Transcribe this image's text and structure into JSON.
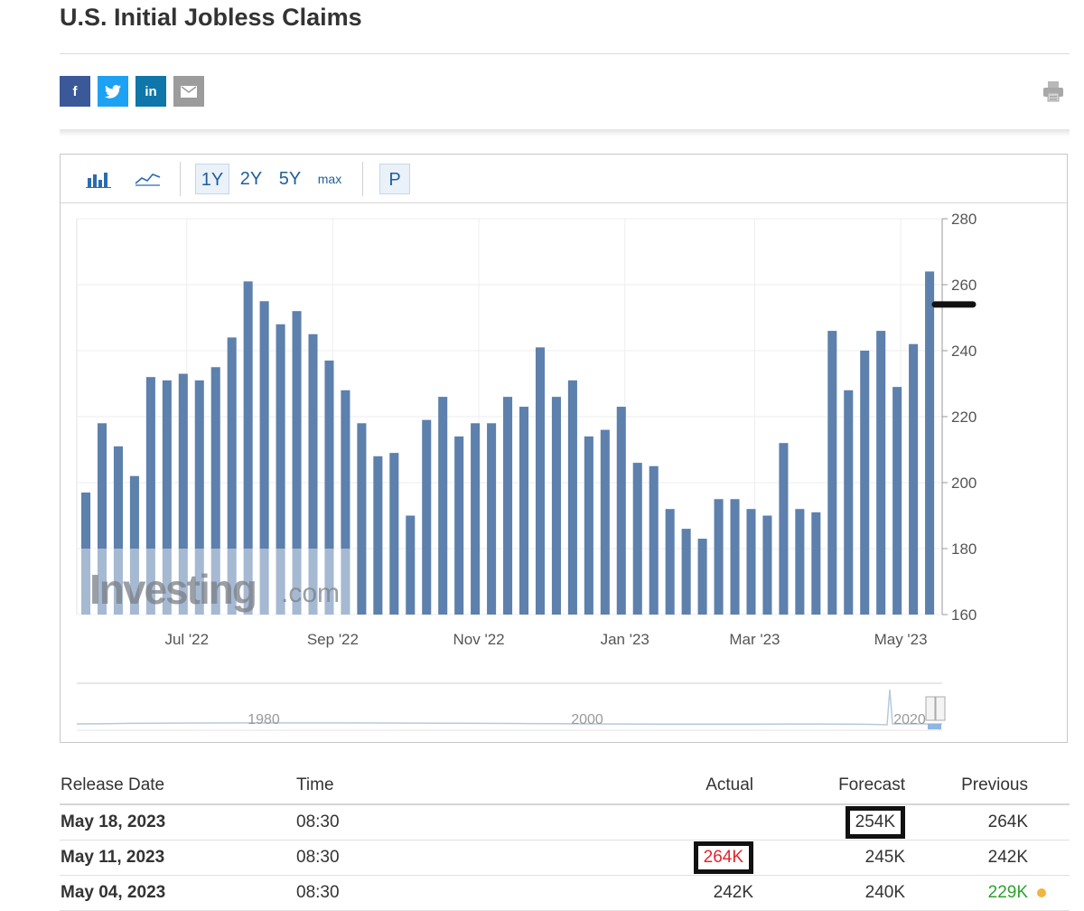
{
  "page": {
    "title": "U.S. Initial Jobless Claims"
  },
  "share": {
    "facebook": "f",
    "twitter": "t",
    "linkedin": "in",
    "email_icon": "envelope-icon",
    "print_icon": "printer-icon"
  },
  "toolbar": {
    "bar_icon": "bar-chart-icon",
    "line_icon": "line-chart-icon",
    "ranges": [
      "1Y",
      "2Y",
      "5Y",
      "max"
    ],
    "selected_range": "1Y",
    "p_label": "P"
  },
  "chart_data": {
    "type": "bar",
    "title": "",
    "xlabel": "",
    "ylabel": "",
    "ylim": [
      160,
      280
    ],
    "yticks": [
      160,
      180,
      200,
      220,
      240,
      260,
      280
    ],
    "xtick_labels": [
      "Jul '22",
      "Sep '22",
      "Nov '22",
      "Jan '23",
      "Mar '23",
      "May '23"
    ],
    "values": [
      197,
      218,
      211,
      202,
      232,
      231,
      233,
      231,
      235,
      244,
      261,
      255,
      248,
      252,
      245,
      237,
      228,
      218,
      208,
      209,
      190,
      219,
      226,
      214,
      218,
      218,
      226,
      223,
      241,
      226,
      231,
      214,
      216,
      223,
      206,
      205,
      192,
      186,
      183,
      195,
      195,
      192,
      190,
      212,
      192,
      191,
      246,
      228,
      240,
      246,
      229,
      242,
      264
    ],
    "forecast_marker": 254,
    "bar_color": "#5d80ad",
    "watermark": "Investing.com",
    "navigator_labels": [
      "1980",
      "2000",
      "2020"
    ]
  },
  "table": {
    "headers": [
      "Release Date",
      "Time",
      "Actual",
      "Forecast",
      "Previous"
    ],
    "rows": [
      {
        "date": "May 18, 2023",
        "time": "08:30",
        "actual": "",
        "forecast": "254K",
        "previous": "264K"
      },
      {
        "date": "May 11, 2023",
        "time": "08:30",
        "actual": "264K",
        "forecast": "245K",
        "previous": "242K"
      },
      {
        "date": "May 04, 2023",
        "time": "08:30",
        "actual": "242K",
        "forecast": "240K",
        "previous": "229K"
      }
    ],
    "colors": {
      "worse": "#e0242d",
      "better": "#2ca12c",
      "dot": "#f0b440"
    }
  }
}
